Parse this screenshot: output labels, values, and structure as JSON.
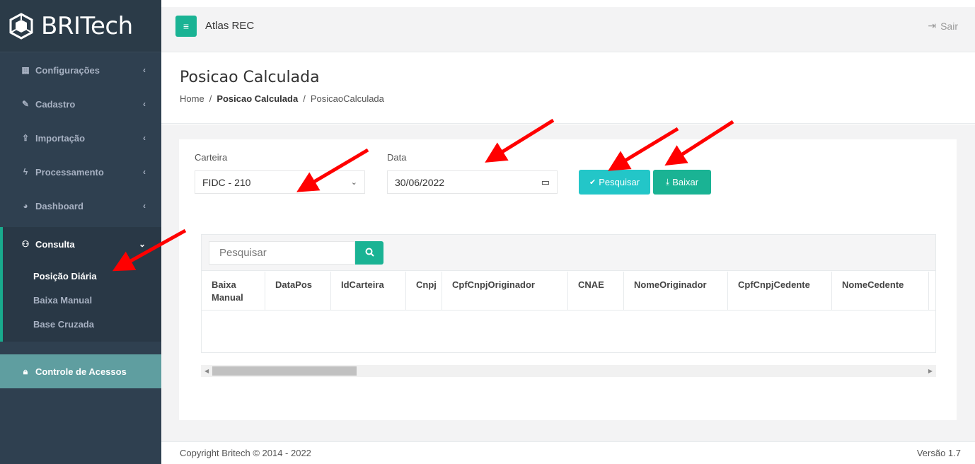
{
  "brand": {
    "name": "BRITech"
  },
  "sidebar": {
    "items": [
      {
        "label": "Configurações",
        "icon": "grid-icon"
      },
      {
        "label": "Cadastro",
        "icon": "edit-icon"
      },
      {
        "label": "Importação",
        "icon": "upload-icon"
      },
      {
        "label": "Processamento",
        "icon": "bolt-icon"
      },
      {
        "label": "Dashboard",
        "icon": "pie-chart-icon"
      },
      {
        "label": "Consulta",
        "icon": "binoculars-icon"
      }
    ],
    "submenu": [
      "Posição Diária",
      "Baixa Manual",
      "Base Cruzada"
    ],
    "access": {
      "label": "Controle de Acessos",
      "icon": "lock-icon"
    }
  },
  "topbar": {
    "app_name": "Atlas REC",
    "logout": "Sair"
  },
  "heading": {
    "title": "Posicao Calculada",
    "breadcrumb": [
      "Home",
      "Posicao Calculada",
      "PosicaoCalculada"
    ]
  },
  "filters": {
    "carteira_label": "Carteira",
    "carteira_value": "FIDC - 210",
    "data_label": "Data",
    "data_value": "30/06/2022",
    "pesquisar": "Pesquisar",
    "baixar": "Baixar"
  },
  "table": {
    "search_placeholder": "Pesquisar",
    "columns": [
      "Baixa Manual",
      "DataPos",
      "IdCarteira",
      "Cnpj",
      "CpfCnpjOriginador",
      "CNAE",
      "NomeOriginador",
      "CpfCnpjCedente",
      "NomeCedente"
    ],
    "rows": []
  },
  "footer": {
    "copyright": "Copyright Britech © 2014 - 2022",
    "version": "Versão 1.7"
  },
  "colors": {
    "sidebar": "#2f4050",
    "accent": "#1ab394",
    "info": "#23c6c8",
    "annotation_arrow": "#ff0000"
  }
}
